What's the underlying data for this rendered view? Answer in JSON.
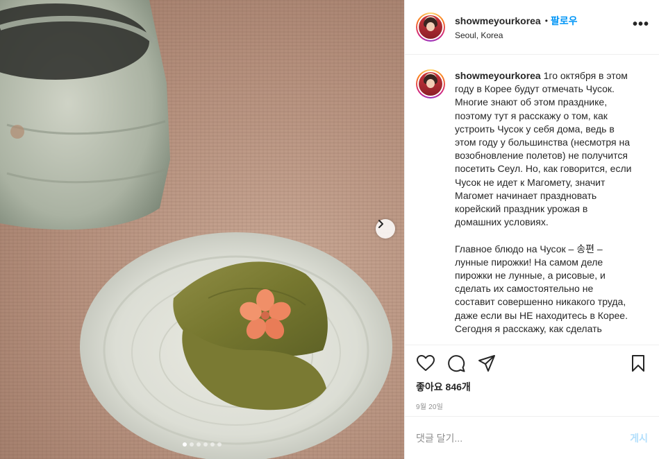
{
  "header": {
    "username": "showmeyourkorea",
    "separator": "•",
    "follow_label": "팔로우",
    "location": "Seoul, Korea",
    "more_icon": "more-options-icon"
  },
  "caption": {
    "username": "showmeyourkorea",
    "text": " 1го октября в этом году в Корее будут отмечать Чусок. Многие знают об этом празднике, поэтому тут я расскажу о том, как устроить Чусок у себя дома, ведь в этом году у большинства (несмотря на возобновление полетов) не получится посетить Сеул. Но, как говорится, если Чусок не идет к Магомету, значит Магомет начинает праздновать корейский праздник урожая в домашних условиях.\n\nГлавное блюдо на Чусок – 송편 – лунные пирожки! На самом деле пирожки не лунные, а рисовые, и сделать их самостоятельно не составит совершенно никакого труда, даже если вы НЕ находитесь в Корее. Сегодня я расскажу, как сделать"
  },
  "actions": {
    "like_icon": "heart-icon",
    "comment_icon": "comment-icon",
    "share_icon": "share-icon",
    "save_icon": "bookmark-icon",
    "likes_text": "좋아요 846개",
    "date": "9월 20일"
  },
  "comment": {
    "placeholder": "댓글 달기...",
    "post_label": "게시"
  },
  "carousel": {
    "total": 6,
    "current": 1,
    "next_icon": "chevron-right-icon"
  }
}
